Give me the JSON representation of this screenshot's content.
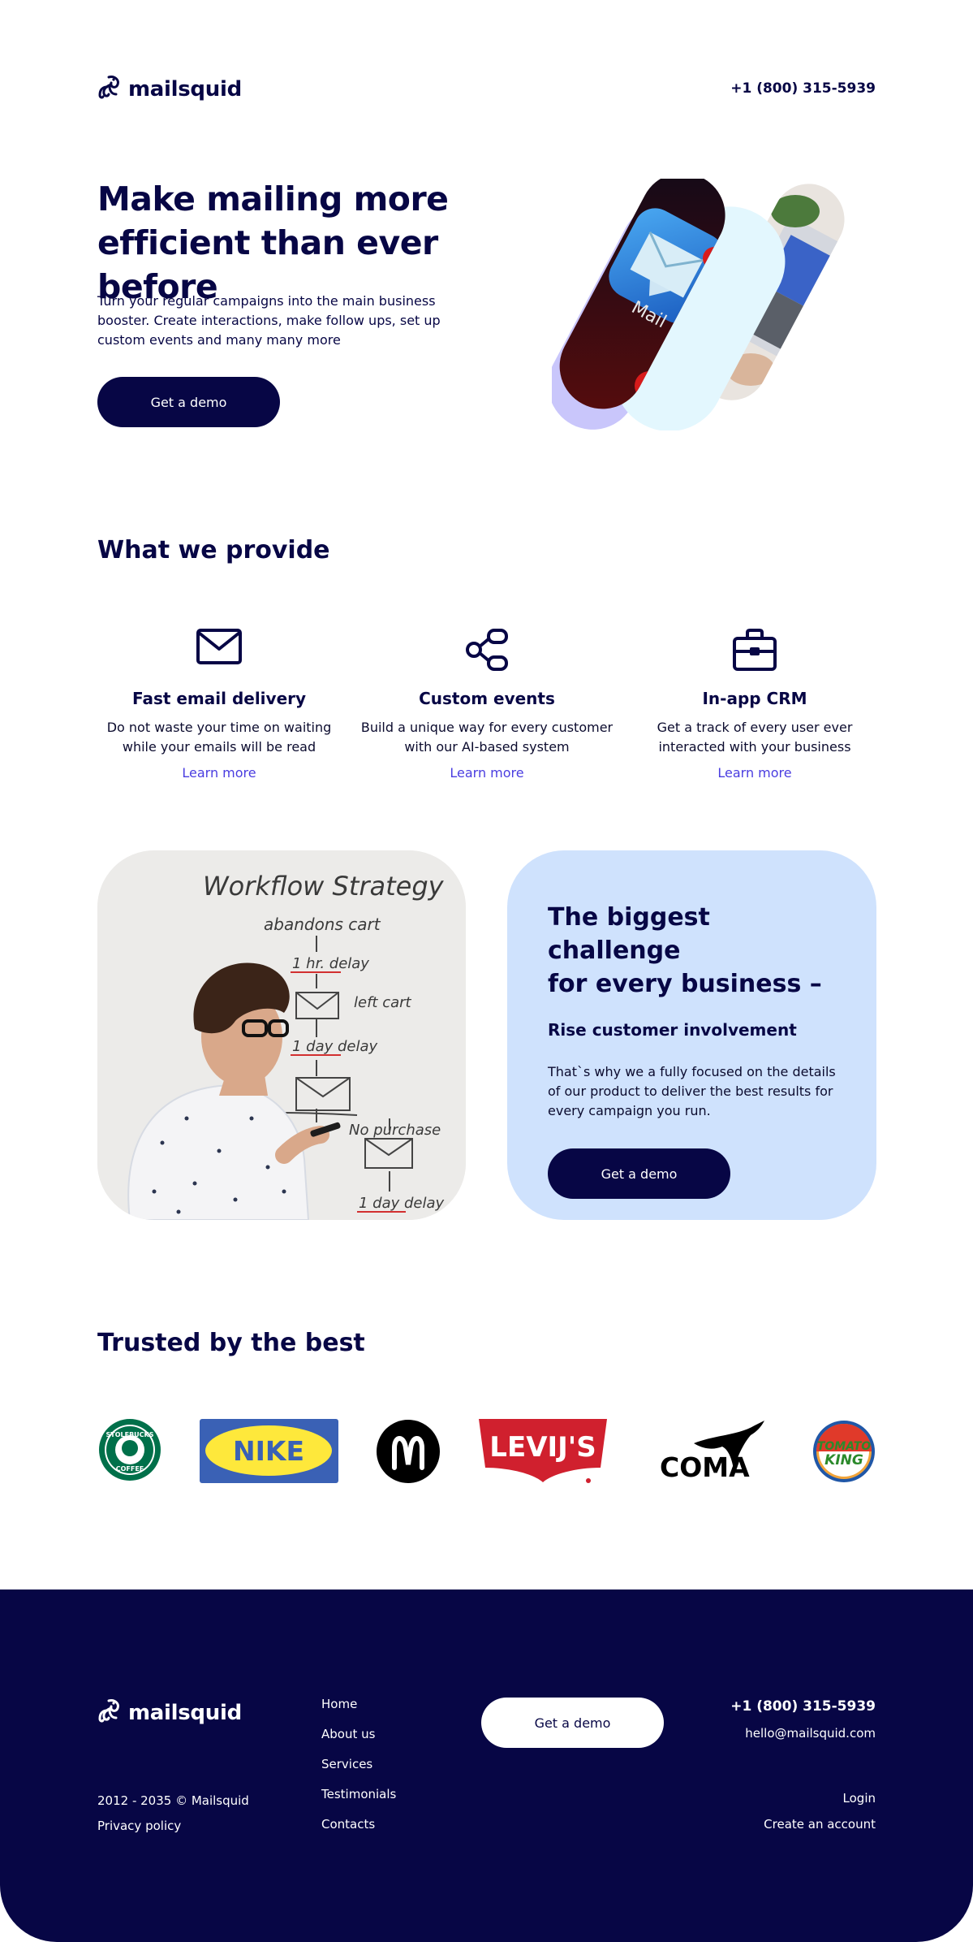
{
  "header": {
    "brand": "mailsquid",
    "phone": "+1 (800) 315-5939"
  },
  "hero": {
    "title_line1": "Make mailing more",
    "title_line2": "efficient than ever before",
    "text": "Turn your regular campaigns into the main business booster. Create interactions, make follow ups, set up custom events and many many more",
    "cta": "Get a demo",
    "mail_app_label": "Mail"
  },
  "provide": {
    "title": "What we provide",
    "features": [
      {
        "icon": "envelope-icon",
        "title": "Fast email delivery",
        "text": "Do not waste your  time on waiting while your emails will be read",
        "link": "Learn more"
      },
      {
        "icon": "share-nodes-icon",
        "title": "Custom events",
        "text": "Build a unique way for every customer with our AI-based system",
        "link": "Learn more"
      },
      {
        "icon": "briefcase-icon",
        "title": "In-app CRM",
        "text": "Get a track of every user ever interacted with your business",
        "link": "Learn more"
      }
    ]
  },
  "whiteboard": {
    "title": "Workflow Strategy",
    "lines": [
      "abandons cart",
      "1 hr. delay",
      "left cart",
      "1 day delay",
      "No purchase",
      "1 day delay"
    ]
  },
  "challenge": {
    "title_line1": "The biggest challenge",
    "title_line2": "for every business –",
    "subtitle": "Rise customer involvement",
    "text": "That`s why we a fully focused on the details of our product to deliver the best results for every campaign you run.",
    "cta": "Get a demo"
  },
  "trusted": {
    "title": "Trusted by the best",
    "logos": {
      "starbucks": [
        "STOLEBUCKS",
        "COFFEE"
      ],
      "nike": "NIKE",
      "levis": "LEVIJ'S",
      "puma": "COMA",
      "burger_king": [
        "TOMATO",
        "KING"
      ]
    }
  },
  "footer": {
    "brand": "mailsquid",
    "copyright": "2012 - 2035 © Mailsquid",
    "privacy": "Privacy policy",
    "nav": [
      "Home",
      "About us",
      "Services",
      "Testimonials",
      "Contacts"
    ],
    "cta": "Get a demo",
    "phone": "+1 (800) 315-5939",
    "email": "hello@mailsquid.com",
    "login": "Login",
    "create_account": "Create an account"
  },
  "colors": {
    "navy": "#070645",
    "accent_link": "#4a3de0",
    "challenge_bg": "#cfe2fd",
    "lavender": "#c9c6fb",
    "light_cyan": "#e3f7fe"
  }
}
